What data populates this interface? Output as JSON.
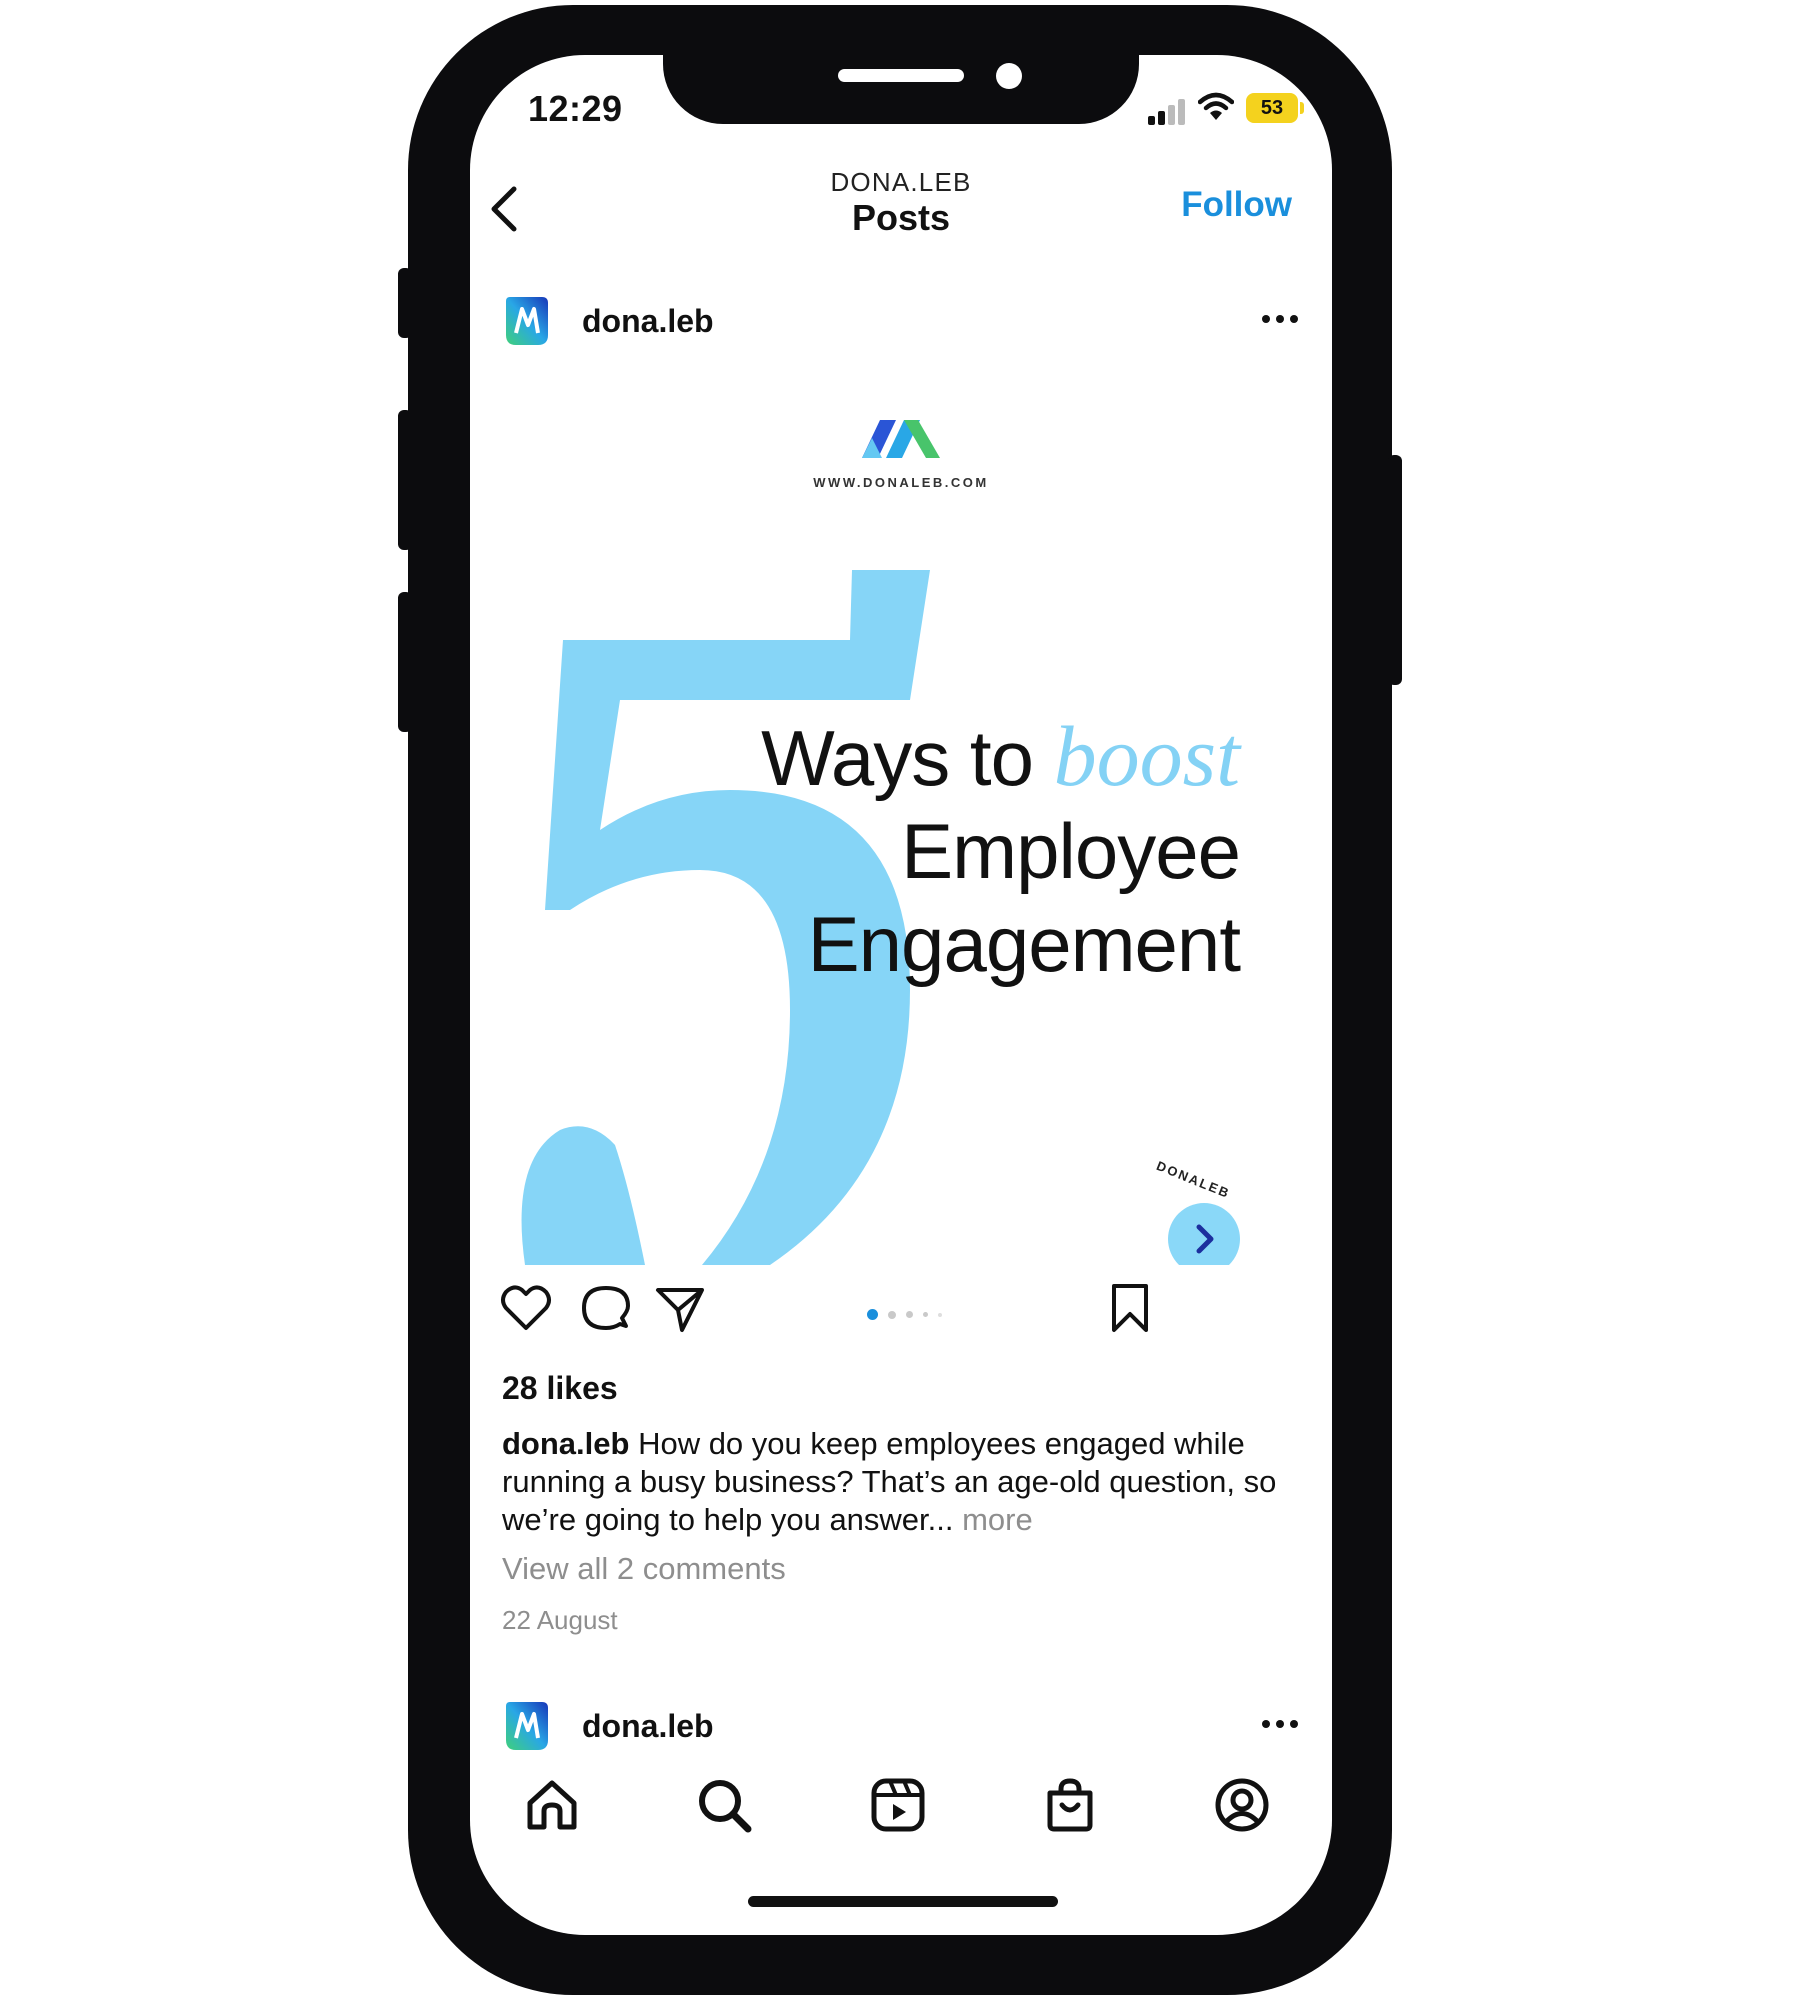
{
  "status_bar": {
    "time": "12:29",
    "battery": "53",
    "icons": [
      "signal-icon",
      "wifi-icon",
      "battery-icon"
    ],
    "battery_color": "#f4d21e"
  },
  "header": {
    "account": "DONA.LEB",
    "title": "Posts",
    "follow_label": "Follow",
    "back_icon": "chevron-left-icon",
    "accent_color": "#1a8fdc"
  },
  "post": {
    "username": "dona.leb",
    "options_icon": "more-horizontal-icon",
    "image": {
      "brand_url": "WWW.DONALEB.COM",
      "big_number": "5",
      "headline_line1_a": "Ways to ",
      "headline_line1_b": "boost",
      "headline_line2": "Employee",
      "headline_line3": "Engagement",
      "brand_mark": "DONALEB",
      "next_icon": "chevron-right-icon",
      "accent_color": "#84d2f5"
    },
    "actions": [
      "heart-icon",
      "comment-icon",
      "share-icon",
      "bookmark-icon"
    ],
    "carousel": {
      "count": 5,
      "active": 1
    },
    "likes": "28 likes",
    "caption_user": "dona.leb",
    "caption_text": " How do you keep employees engaged while running a busy business? That’s an age-old question, so we’re going to help you answer...",
    "caption_more": " more",
    "view_comments": "View all 2 comments",
    "date": "22 August"
  },
  "next_post": {
    "username": "dona.leb"
  },
  "tab_bar": {
    "items": [
      "home-icon",
      "search-icon",
      "reels-icon",
      "shop-icon",
      "profile-icon"
    ]
  }
}
